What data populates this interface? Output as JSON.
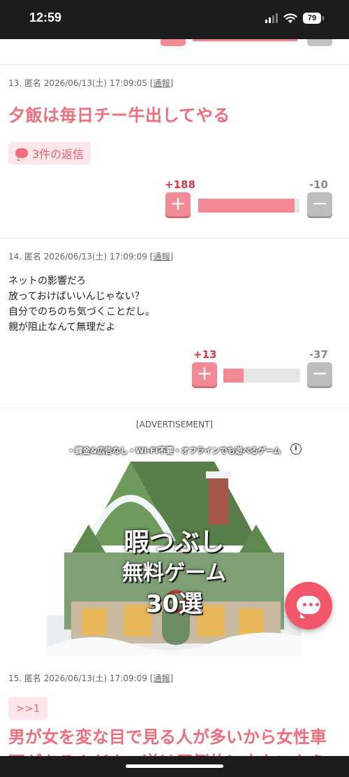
{
  "status_bar": {
    "time": "12:59",
    "battery": "79"
  },
  "comments": [
    {
      "meta": "13. 匿名 2026/06/13(土) 17:09:05",
      "report": "[通報]",
      "title": "夕飯は毎日チー牛出してやる",
      "reply_label": "3件の返信",
      "plus": "+188",
      "minus": "-10",
      "ratio": 0.95
    },
    {
      "meta": "14. 匿名 2026/06/13(土) 17:09:09",
      "report": "[通報]",
      "body": "ネットの影響だろ\n放っておけばいいんじゃない？\n自分でのちのち気づくことだし。\n親が阻止なんて無理だよ",
      "plus": "+13",
      "minus": "-37",
      "ratio": 0.26
    },
    {
      "meta": "15. 匿名 2026/06/13(土) 17:09:09",
      "report": "[通報]",
      "anchor": ">>1",
      "title": "男が女を変な目で見る人が多いから女性車両があるんだよ、逆は圧倒的に少ないから"
    }
  ],
  "ad": {
    "label": "[ADVERTISEMENT]",
    "caption": "・課金&広告なし・WI-FI不要・オフラインでも遊べるゲーム",
    "line1": "暇つぶし",
    "line2": "無料ゲーム",
    "line3": "30選",
    "info": "i"
  },
  "icons": {
    "chat": "chat-bubble-icon",
    "reply": "speech-bubble-icon",
    "plus": "plus-icon",
    "minus": "minus-icon"
  },
  "colors": {
    "accent": "#ee6e7e",
    "plus_button": "#f28a95",
    "minus_button": "#bdbdbd",
    "fab": "#f1566a"
  }
}
